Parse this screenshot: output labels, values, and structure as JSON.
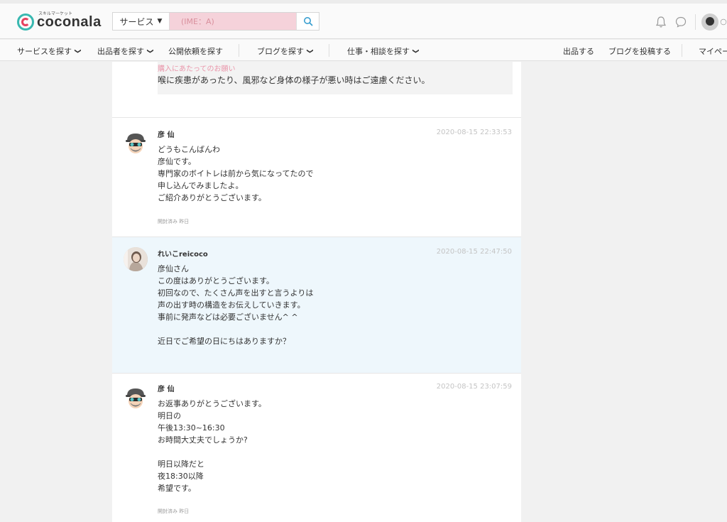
{
  "header": {
    "logo_sub": "スキルマーケット",
    "logo_text": "coconala",
    "search_category": "サービス",
    "search_placeholder": "(IME：A)"
  },
  "nav": {
    "left": [
      {
        "label": "サービスを探す",
        "chevron": true
      },
      {
        "label": "出品者を探す",
        "chevron": true
      },
      {
        "label": "公開依頼を探す",
        "chevron": false
      },
      {
        "label": "ブログを探す",
        "chevron": true
      },
      {
        "label": "仕事・相談を探す",
        "chevron": true
      }
    ],
    "right": [
      {
        "label": "出品する"
      },
      {
        "label": "ブログを投稿する"
      },
      {
        "label": "マイペー"
      }
    ]
  },
  "quote": {
    "cut_text": "購入にあたってのお願い",
    "text": "喉に疾患があったり、風邪など身体の様子が悪い時はご遠慮ください。"
  },
  "messages": [
    {
      "sender": "彦 仙",
      "time": "2020-08-15 22:33:53",
      "lines": [
        "どうもこんばんわ",
        "彦仙です。",
        "専門家のボイトレは前から気になってたので",
        "申し込んでみましたよ。",
        "ご紹介ありがとうございます。"
      ],
      "read": "開封済み 昨日"
    },
    {
      "sender": "れいこreicoco",
      "time": "2020-08-15 22:47:50",
      "lines": [
        "彦仙さん",
        "この度はありがとうございます。",
        "初回なので、たくさん声を出すと言うよりは",
        "声の出す時の構造をお伝えしていきます。",
        "事前に発声などは必要ございません^ ^",
        "",
        "近日でご希望の日にちはありますか？"
      ],
      "read": ""
    },
    {
      "sender": "彦 仙",
      "time": "2020-08-15 23:07:59",
      "lines": [
        "お返事ありがとうございます。",
        "明日の",
        "午後13:30~16:30",
        "お時間大丈夫でしょうか?",
        "",
        "明日以降だと",
        "夜18:30以降",
        "希望です。"
      ],
      "read": "開封済み 昨日"
    }
  ],
  "colors": {
    "brand_teal": "#38b8b0",
    "brand_pink": "#e6405e",
    "highlight_bg": "#eef7fc"
  }
}
